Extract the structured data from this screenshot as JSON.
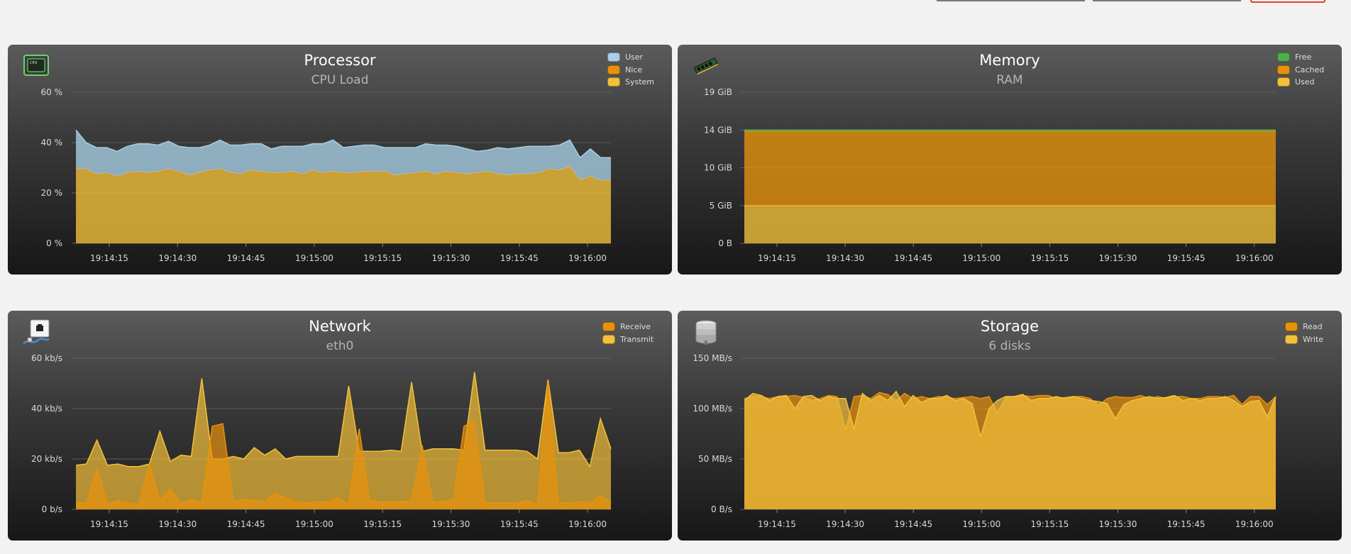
{
  "colors": {
    "user": "#a8cfe6",
    "nice": "#e8920c",
    "system": "#f3c13a",
    "free": "#4cb04c",
    "cached": "#e8920c",
    "used": "#f3c13a",
    "receive": "#e8920c",
    "transmit": "#f3c13a",
    "read": "#e8920c",
    "write": "#f3c13a"
  },
  "panels": {
    "processor": {
      "title": "Processor",
      "subtitle": "CPU Load",
      "icon": "cpu-chip-icon",
      "legend": [
        "User",
        "Nice",
        "System"
      ]
    },
    "memory": {
      "title": "Memory",
      "subtitle": "RAM",
      "icon": "ram-module-icon",
      "legend": [
        "Free",
        "Cached",
        "Used"
      ]
    },
    "network": {
      "title": "Network",
      "subtitle": "eth0",
      "icon": "network-icon",
      "legend": [
        "Receive",
        "Transmit"
      ]
    },
    "storage": {
      "title": "Storage",
      "subtitle": "6 disks",
      "icon": "database-icon",
      "legend": [
        "Read",
        "Write"
      ]
    }
  },
  "chart_data": [
    {
      "id": "processor",
      "type": "area",
      "stacked": true,
      "ylim": [
        0,
        60
      ],
      "yticks": [
        "0 %",
        "20 %",
        "40 %",
        "60 %"
      ],
      "xticks": [
        "19:14:15",
        "19:14:30",
        "19:14:45",
        "19:15:00",
        "19:15:15",
        "19:15:30",
        "19:15:45",
        "19:16:00"
      ],
      "series": [
        {
          "name": "System",
          "color": "system",
          "values": [
            29.5,
            29.5,
            27.5,
            28,
            26.5,
            28,
            28.5,
            28,
            28.5,
            29.5,
            28.5,
            27,
            28,
            29,
            29.5,
            28,
            27.5,
            29,
            28.5,
            28,
            28,
            28.5,
            27.5,
            29,
            28,
            28.5,
            28,
            28,
            28.5,
            28.5,
            28.5,
            27,
            27.5,
            28,
            28.5,
            27.5,
            28.5,
            28,
            27.5,
            28,
            28.5,
            27.5,
            27,
            27.5,
            27.5,
            28,
            29.5,
            29,
            30.5,
            25,
            26.5,
            25,
            25
          ]
        },
        {
          "name": "Nice",
          "color": "nice",
          "values": [
            0,
            0,
            0,
            0,
            0,
            0,
            0,
            0,
            0,
            0,
            0,
            0,
            0,
            0,
            0,
            0,
            0,
            0,
            0,
            0,
            0,
            0,
            0,
            0,
            0,
            0,
            0,
            0,
            0,
            0,
            0,
            0,
            0,
            0,
            0,
            0,
            0,
            0,
            0,
            0,
            0,
            0,
            0,
            0,
            0,
            0,
            0,
            0,
            0,
            0,
            0,
            0,
            0
          ]
        },
        {
          "name": "User",
          "color": "user",
          "values": [
            15.5,
            10.5,
            10.5,
            10,
            10,
            10.5,
            11,
            11.5,
            10.5,
            11,
            10,
            11,
            10,
            10,
            11.5,
            11,
            11.5,
            10.5,
            11,
            9.5,
            10.5,
            10,
            11,
            10.5,
            11.5,
            12.5,
            10,
            10.5,
            10.5,
            10.5,
            9.5,
            11,
            10.5,
            10,
            11,
            11.5,
            10.5,
            10.5,
            10,
            8.5,
            8.5,
            10.5,
            10.5,
            10.5,
            11,
            10.5,
            9,
            10,
            10.5,
            9,
            11,
            9,
            9
          ]
        }
      ]
    },
    {
      "id": "memory",
      "type": "area",
      "stacked": true,
      "ylim": [
        0,
        19
      ],
      "yticks": [
        "0 B",
        "5 GiB",
        "10 GiB",
        "14 GiB",
        "19 GiB"
      ],
      "ytick_values": [
        0,
        4.75,
        9.5,
        14.25,
        19
      ],
      "xticks": [
        "19:14:15",
        "19:14:30",
        "19:14:45",
        "19:15:00",
        "19:15:15",
        "19:15:30",
        "19:15:45",
        "19:16:00"
      ],
      "series": [
        {
          "name": "Used",
          "color": "used",
          "values": [
            4.75,
            4.75,
            4.75,
            4.75,
            4.75,
            4.75,
            4.75,
            4.75,
            4.75,
            4.75,
            4.75,
            4.75,
            4.75
          ]
        },
        {
          "name": "Cached",
          "color": "cached",
          "values": [
            9.35,
            9.35,
            9.35,
            9.35,
            9.35,
            9.35,
            9.35,
            9.35,
            9.35,
            9.35,
            9.35,
            9.35,
            9.35
          ]
        },
        {
          "name": "Free",
          "color": "free",
          "values": [
            0.15,
            0.15,
            0.15,
            0.15,
            0.15,
            0.15,
            0.15,
            0.15,
            0.15,
            0.15,
            0.15,
            0.15,
            0.15
          ]
        }
      ]
    },
    {
      "id": "network",
      "type": "area",
      "stacked": false,
      "ylim": [
        0,
        60
      ],
      "yticks": [
        "0 b/s",
        "20 kb/s",
        "40 kb/s",
        "60 kb/s"
      ],
      "xticks": [
        "19:14:15",
        "19:14:30",
        "19:14:45",
        "19:15:00",
        "19:15:15",
        "19:15:30",
        "19:15:45",
        "19:16:00"
      ],
      "series": [
        {
          "name": "Transmit",
          "color": "transmit",
          "values": [
            17.5,
            18,
            27.5,
            17.5,
            18,
            17,
            17,
            18,
            31,
            19,
            21.5,
            21,
            52,
            20,
            20,
            21,
            20,
            24.5,
            21.5,
            24,
            20,
            21,
            21,
            21,
            21,
            21,
            49,
            23,
            23,
            23,
            23.5,
            23,
            50.5,
            23,
            24,
            24,
            24,
            23.5,
            54.5,
            23.5,
            23.5,
            23.5,
            23.5,
            23,
            20,
            51.5,
            22.5,
            22.5,
            23.5,
            17,
            36,
            24
          ]
        },
        {
          "name": "Receive",
          "color": "receive",
          "values": [
            2.5,
            2.5,
            16,
            2,
            3.5,
            2.5,
            2,
            18,
            3.5,
            8,
            2.5,
            4,
            2.5,
            33,
            34,
            3,
            4,
            3.5,
            3,
            6.5,
            4.5,
            3,
            2.5,
            3,
            3,
            4.5,
            2,
            32,
            3.5,
            3,
            3,
            3,
            3.5,
            25.5,
            3,
            3,
            4,
            33,
            35,
            2.5,
            2.5,
            2.5,
            2.5,
            3.5,
            2,
            50.5,
            2.5,
            2.5,
            3,
            2.5,
            5.5,
            2.5
          ]
        }
      ]
    },
    {
      "id": "storage",
      "type": "area",
      "stacked": false,
      "ylim": [
        0,
        150
      ],
      "yticks": [
        "0 B/s",
        "50 MB/s",
        "100 MB/s",
        "150 MB/s"
      ],
      "xticks": [
        "19:14:15",
        "19:14:30",
        "19:14:45",
        "19:15:00",
        "19:15:15",
        "19:15:30",
        "19:15:45",
        "19:16:00"
      ],
      "series": [
        {
          "name": "Read",
          "color": "read",
          "values": [
            110,
            112,
            112,
            110,
            112,
            112,
            113,
            111,
            108,
            110,
            113,
            112,
            79,
            112,
            113,
            110,
            116,
            114,
            108,
            115,
            110,
            112,
            110,
            112,
            111,
            110,
            111,
            112,
            110,
            112,
            96,
            111,
            112,
            113,
            112,
            113,
            113,
            110,
            111,
            112,
            112,
            110,
            103,
            110,
            112,
            111,
            111,
            113,
            110,
            112,
            110,
            112,
            112,
            110,
            110,
            112,
            112,
            111,
            113,
            104,
            112,
            112,
            104,
            112
          ]
        },
        {
          "name": "Write",
          "color": "write",
          "values": [
            108,
            115,
            113,
            108,
            112,
            113,
            100,
            112,
            113,
            108,
            112,
            110,
            110,
            80,
            115,
            108,
            113,
            108,
            117,
            102,
            113,
            106,
            110,
            110,
            113,
            108,
            110,
            105,
            72,
            100,
            108,
            112,
            112,
            114,
            108,
            110,
            110,
            112,
            110,
            112,
            110,
            108,
            107,
            105,
            90,
            104,
            108,
            110,
            112,
            110,
            111,
            113,
            108,
            110,
            108,
            110,
            110,
            112,
            108,
            102,
            107,
            108,
            92,
            112
          ]
        }
      ]
    }
  ]
}
